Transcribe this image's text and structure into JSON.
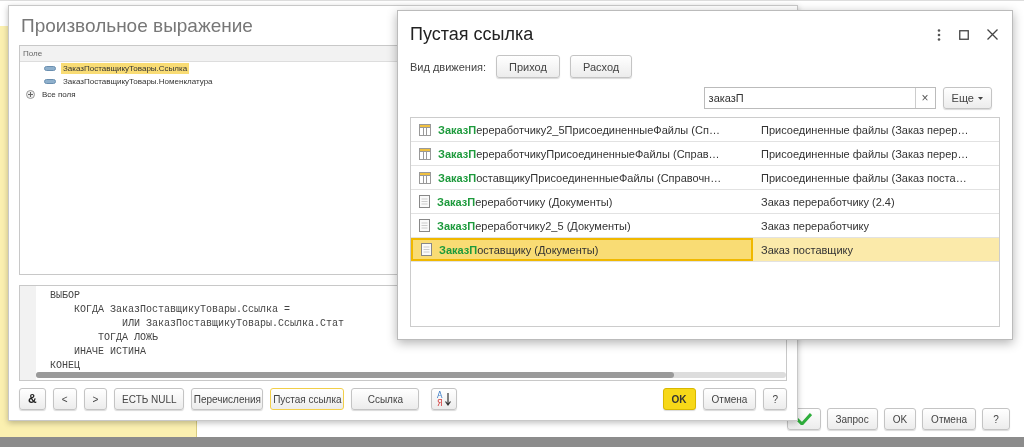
{
  "background_window": {
    "buttons": [
      {
        "kind": "check"
      },
      {
        "kind": "text",
        "label": "Запрос"
      },
      {
        "kind": "text",
        "label": "OK"
      },
      {
        "kind": "text",
        "label": "Отмена"
      },
      {
        "kind": "text",
        "label": "?"
      }
    ]
  },
  "expression_window": {
    "title": "Произвольное выражение",
    "tree": {
      "header": "Поле",
      "items": [
        {
          "label": "ЗаказПоставщикуТовары.Ссылка",
          "kind": "field",
          "selected": true
        },
        {
          "label": "ЗаказПоставщикуТовары.Номенклатура",
          "kind": "field",
          "selected": false
        },
        {
          "label": "Все поля",
          "kind": "group",
          "selected": false
        }
      ]
    },
    "code_lines": [
      "ВЫБОР",
      "    КОГДА ЗаказПоставщикуТовары.Ссылка =",
      "            ИЛИ ЗаказПоставщикуТовары.Ссылка.Стат",
      "        ТОГДА ЛОЖЬ",
      "    ИНАЧЕ ИСТИНА",
      "КОНЕЦ"
    ],
    "tool_buttons": [
      {
        "label": "&",
        "selected": false
      },
      {
        "label": "<",
        "selected": false
      },
      {
        "label": ">",
        "selected": false
      },
      {
        "label": "ЕСТЬ NULL",
        "selected": false
      },
      {
        "label": "Перечисления",
        "selected": false
      },
      {
        "label": "Пустая ссылка",
        "selected": true
      },
      {
        "label": "Ссылка",
        "selected": false
      }
    ],
    "sort_icon_letters": [
      "А",
      "Я"
    ],
    "buttons": [
      {
        "label": "OK",
        "kind": "default"
      },
      {
        "label": "Отмена",
        "kind": "normal"
      },
      {
        "label": "?",
        "kind": "normal"
      }
    ]
  },
  "dialog": {
    "title": "Пустая ссылка",
    "movement_label": "Вид движения:",
    "movement_buttons": [
      "Приход",
      "Расход"
    ],
    "search": {
      "value": "заказП"
    },
    "clear_button": "×",
    "more_button": "Еще",
    "rows": [
      {
        "kind": "catalog",
        "name": "**ЗаказП**ереработчику2_5ПрисоединенныеФайлы (Сп…",
        "description": "Присоединенные файлы (Заказ перер…",
        "selected": false
      },
      {
        "kind": "catalog",
        "name": "**ЗаказП**ереработчикуПрисоединенныеФайлы (Справ…",
        "description": "Присоединенные файлы (Заказ перер…",
        "selected": false
      },
      {
        "kind": "catalog",
        "name": "**ЗаказП**оставщикуПрисоединенныеФайлы (Справочн…",
        "description": "Присоединенные файлы (Заказ поста…",
        "selected": false
      },
      {
        "kind": "document",
        "name": "**ЗаказП**ереработчику (Документы)",
        "description": "Заказ переработчику (2.4)",
        "selected": false
      },
      {
        "kind": "document",
        "name": "**ЗаказП**ереработчику2_5 (Документы)",
        "description": "Заказ переработчику",
        "selected": false
      },
      {
        "kind": "document",
        "name": "**ЗаказП**оставщику (Документы)",
        "description": "Заказ поставщику",
        "selected": true
      }
    ]
  }
}
